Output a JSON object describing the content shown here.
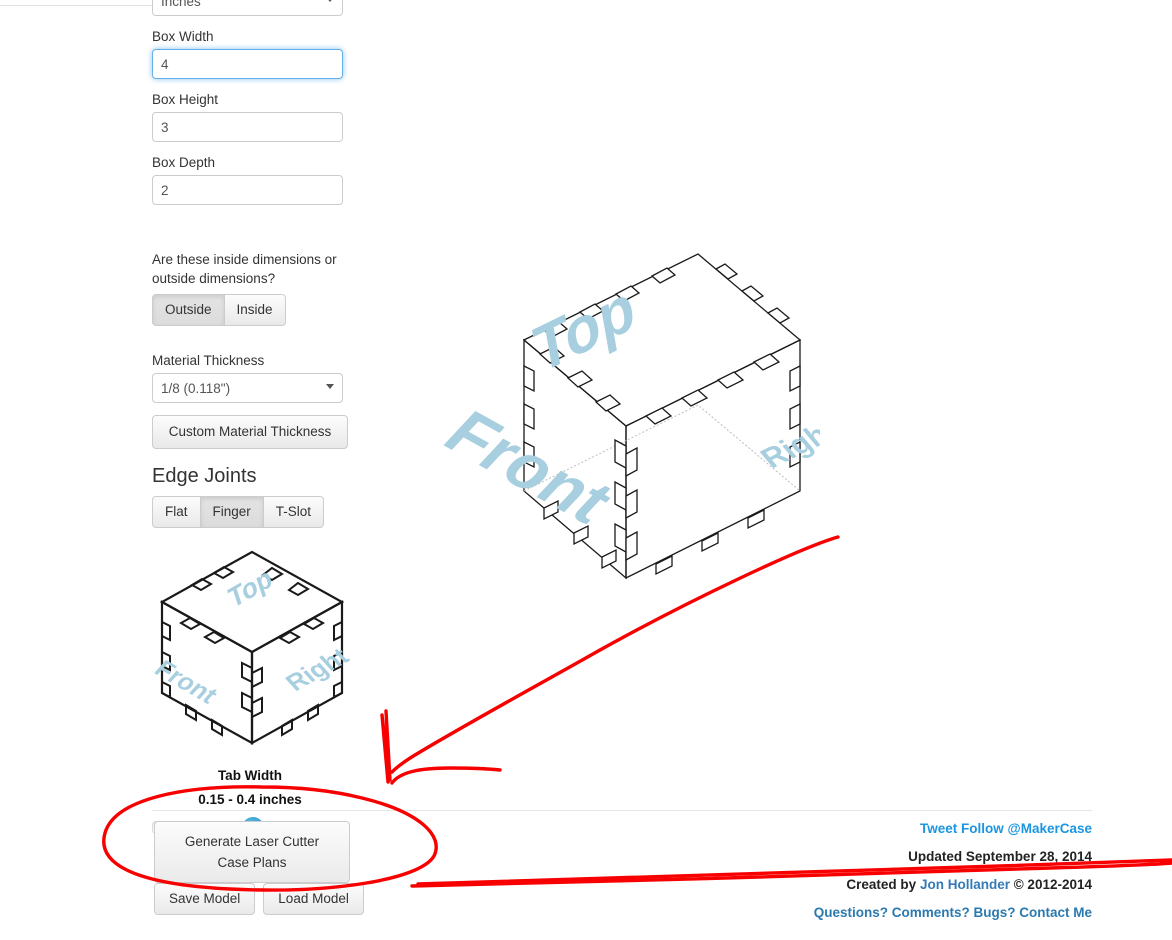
{
  "form": {
    "units": {
      "label": "",
      "value": "Inches",
      "icon": "chevron-down-icon"
    },
    "box_width": {
      "label": "Box Width",
      "value": "4"
    },
    "box_height": {
      "label": "Box Height",
      "value": "3"
    },
    "box_depth": {
      "label": "Box Depth",
      "value": "2"
    },
    "dimension_question": "Are these inside dimensions or outside dimensions?",
    "dimension_options": [
      "Outside",
      "Inside"
    ],
    "dimension_selected": "Outside",
    "material_thickness_label": "Material Thickness",
    "material_thickness_value": "1/8 (0.118\")",
    "custom_material_button": "Custom Material Thickness",
    "edge_joints_title": "Edge Joints",
    "edge_joint_options": [
      "Flat",
      "Finger",
      "T-Slot"
    ],
    "edge_joint_selected": "Finger",
    "tab_width_title": "Tab Width",
    "tab_width_range": "0.15 - 0.4 inches",
    "tab_width_percent": 53
  },
  "actions": {
    "generate": "Generate Laser Cutter Case Plans",
    "generate_line1": "Generate Laser Cutter",
    "generate_line2": "Case Plans",
    "save": "Save Model",
    "load": "Load Model"
  },
  "preview": {
    "face_top": "Top",
    "face_front": "Front",
    "face_right": "Right",
    "label_color": "#a8cfdf",
    "line_color": "#1a1a1a"
  },
  "footer": {
    "tweet": "Tweet Follow @MakerCase",
    "updated_prefix": "Updated",
    "updated_date": "September 28, 2014",
    "created_prefix": "Created by",
    "created_author": "Jon Hollander",
    "created_copyright": "© 2012-2014",
    "questions": "Questions? Comments? Bugs? Contact Me"
  },
  "annotation": {
    "color": "#f80000",
    "shapes": [
      "arrow-to-generate",
      "oval-around-generate",
      "underline-sweep"
    ]
  }
}
